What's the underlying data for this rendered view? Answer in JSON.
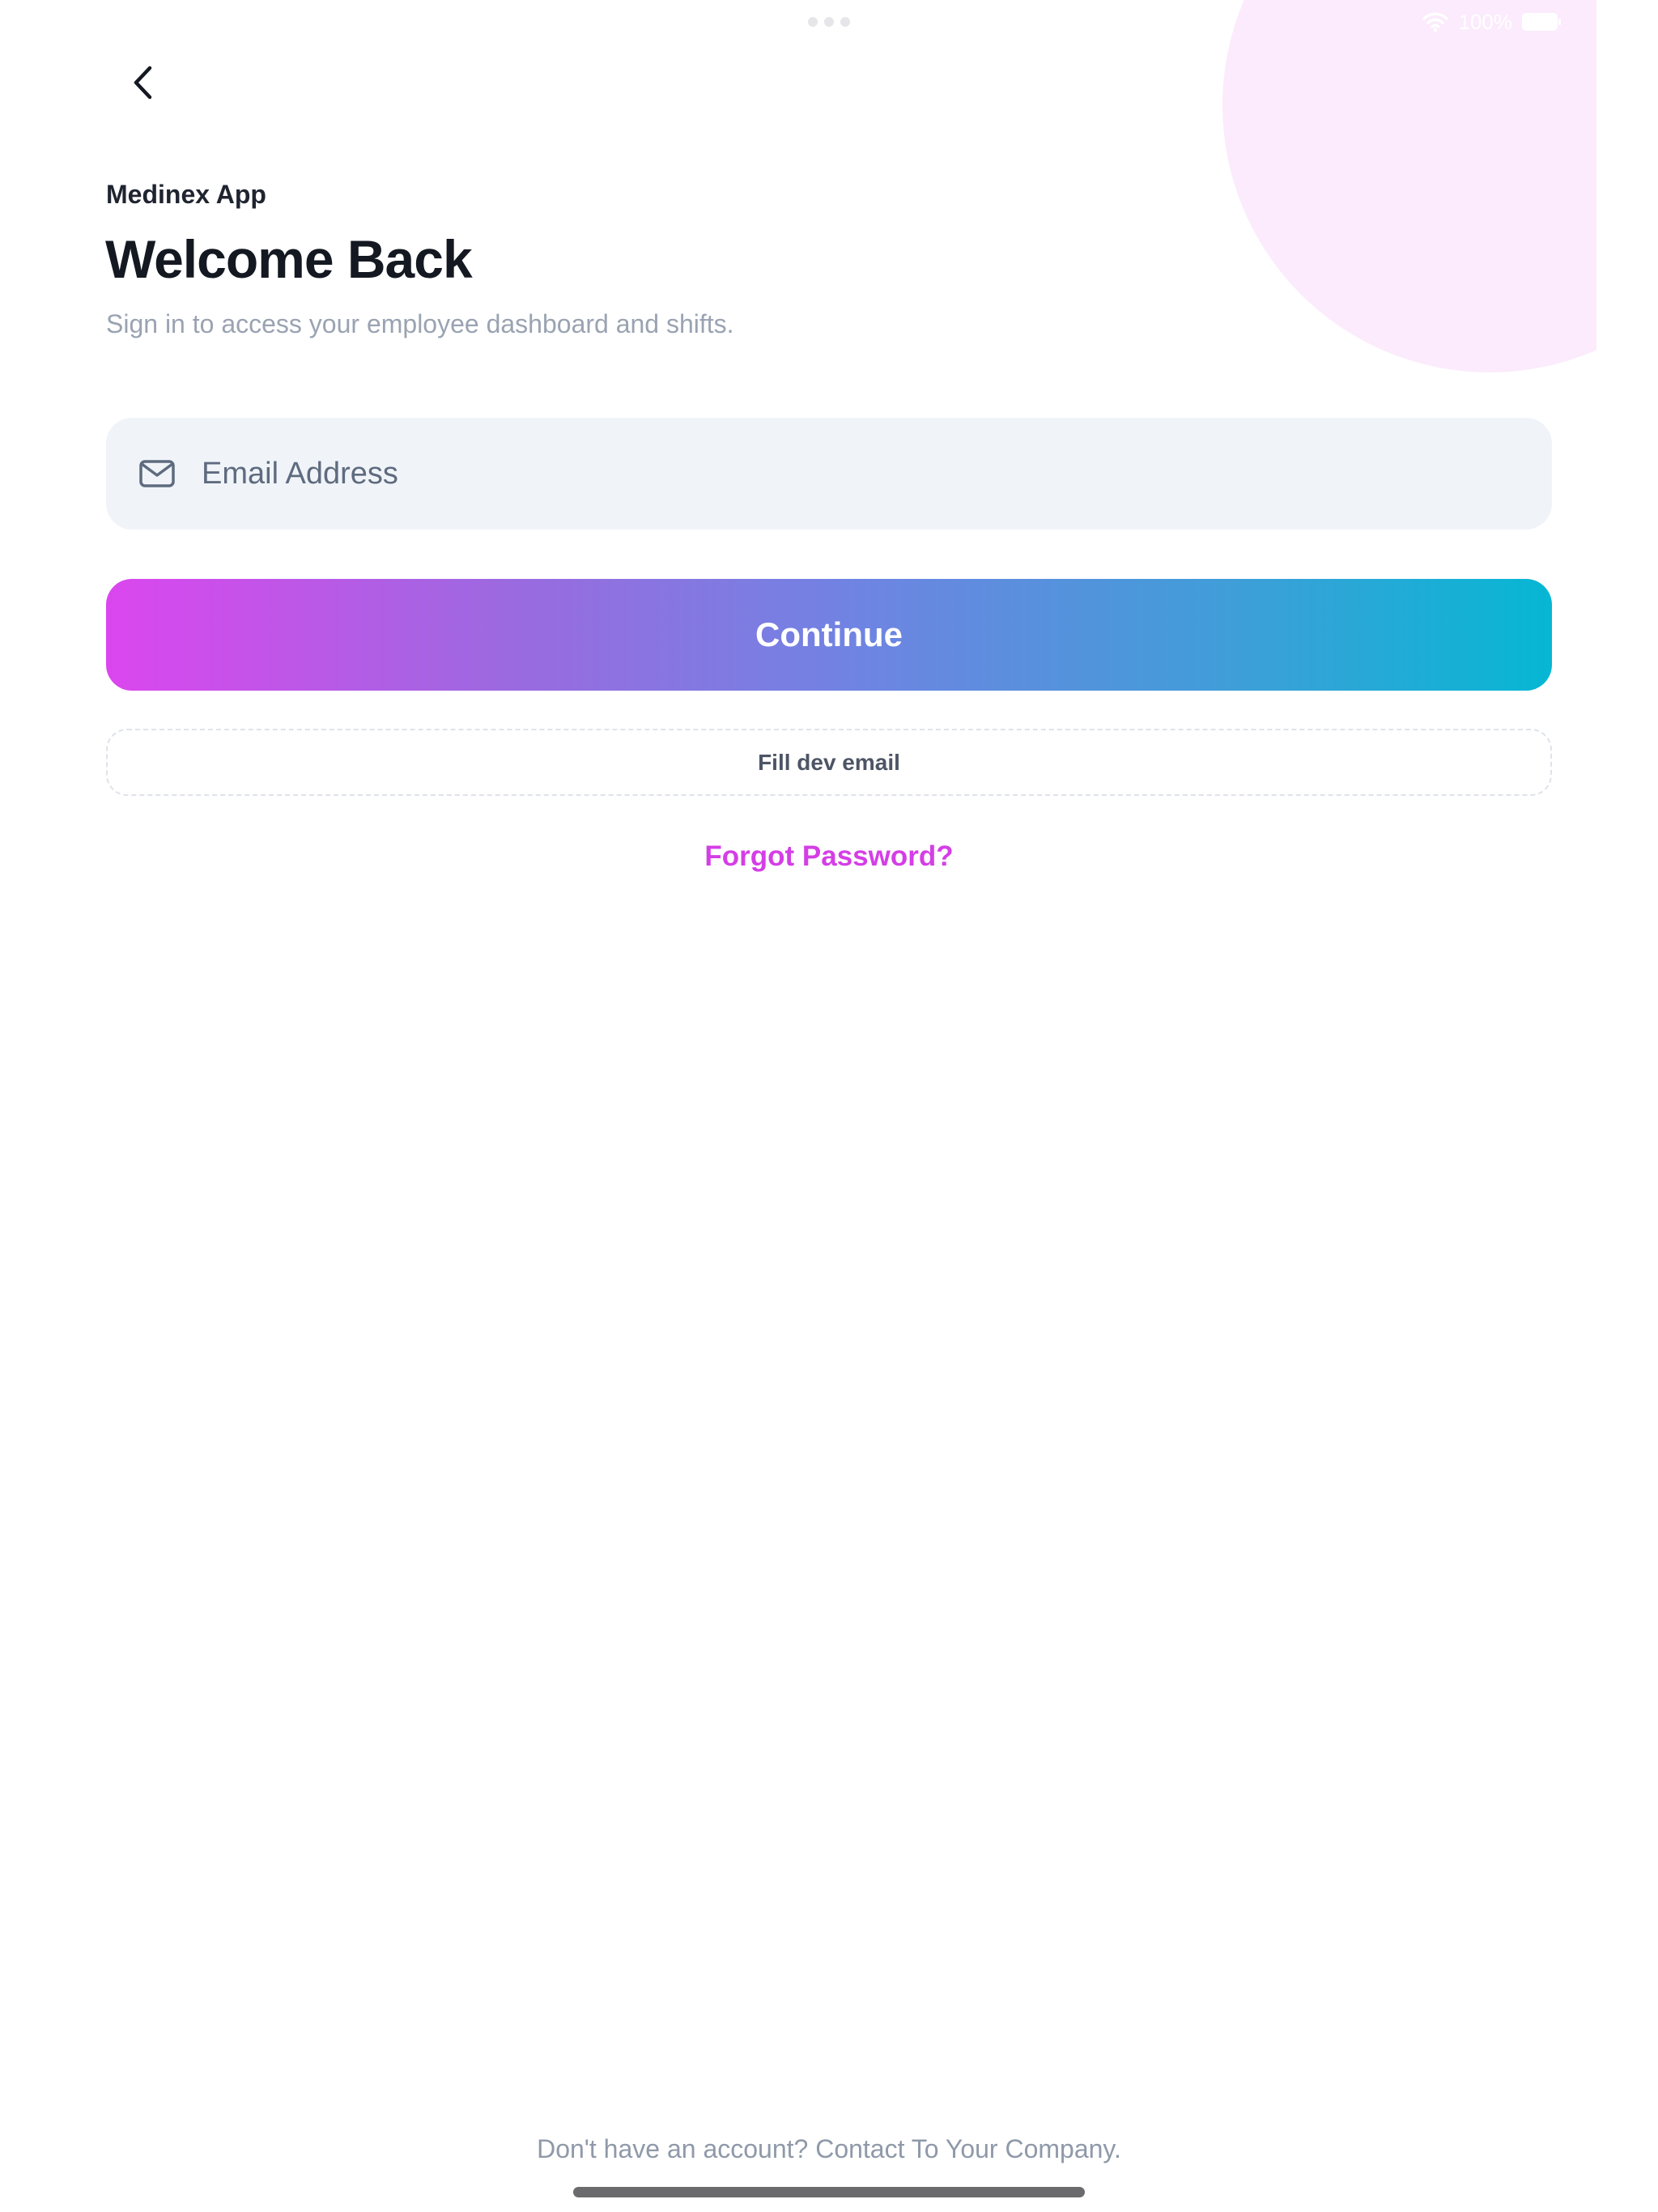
{
  "app": {
    "label": "Medinex App",
    "title": "Welcome Back",
    "subtitle": "Sign in to access your employee dashboard and shifts."
  },
  "status_bar": {
    "battery": "100%"
  },
  "form": {
    "email_placeholder": "Email Address",
    "email_value": "",
    "continue_label": "Continue",
    "dev_email_label": "Fill dev email",
    "forgot_label": "Forgot Password?"
  },
  "footer": {
    "text": "Don't have an account? Contact To Your Company."
  },
  "colors": {
    "accent_magenta": "#d43ee6",
    "accent_cyan": "#06b7d4",
    "field_bg": "#f0f4f8",
    "decor_pink": "#fbebfc"
  },
  "icons": {
    "back": "chevron-left-icon",
    "email": "mail-icon",
    "wifi": "wifi-icon",
    "battery": "battery-icon"
  }
}
